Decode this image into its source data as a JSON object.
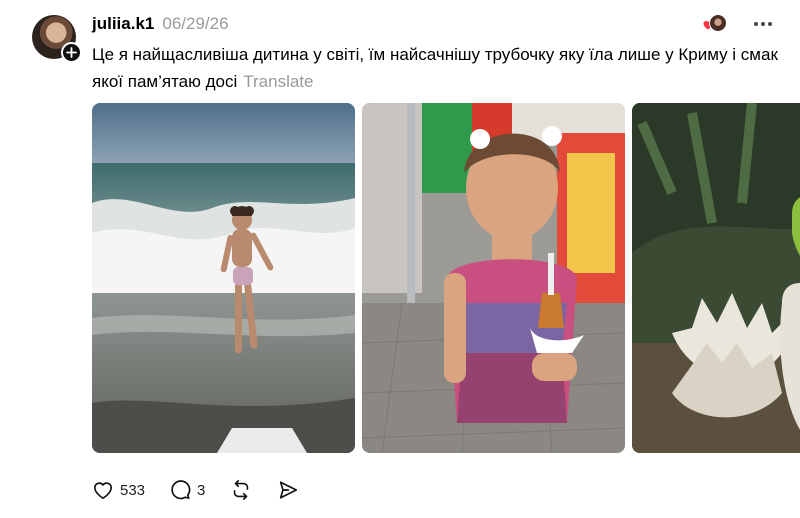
{
  "post": {
    "username": "juliia.k1",
    "timestamp": "06/29/26",
    "caption": "Це я найщасливіша дитина у світі, їм найсачнішу трубочку яку їла лише у Криму і смак якої пам’ятаю досі",
    "translate_label": "Translate"
  },
  "actions": {
    "likes": "533",
    "comments": "3"
  },
  "icons": {
    "follow": "plus-icon",
    "more": "more-horizontal-icon",
    "like": "heart-icon",
    "comment": "comment-icon",
    "repost": "repost-icon",
    "share": "send-icon",
    "liked_by": "heart-icon"
  },
  "colors": {
    "secondary_text": "#999999",
    "heart_red": "#ff3040",
    "text": "#000000"
  }
}
